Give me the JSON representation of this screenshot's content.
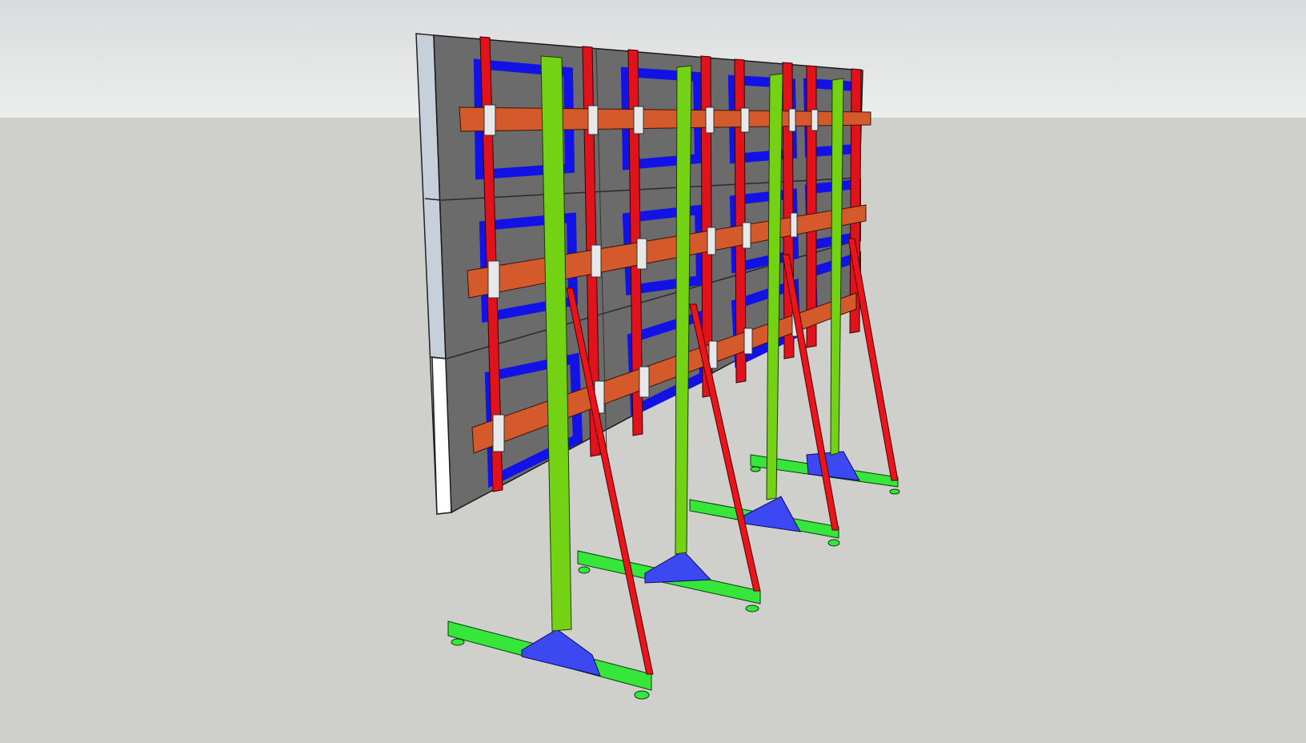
{
  "viewport": {
    "sky_color": "#e6e8e9",
    "ground_color": "#cfd0cc"
  },
  "model": {
    "components": [
      {
        "name": "wall-panel-face",
        "color": "#6d6d6d"
      },
      {
        "name": "wall-panel-edge",
        "color": "#c9d2dc"
      },
      {
        "name": "vertical-stiffener",
        "color": "#e0121c"
      },
      {
        "name": "panel-frame",
        "color": "#1416e6"
      },
      {
        "name": "horizontal-waler",
        "color": "#d85a2a"
      },
      {
        "name": "support-post",
        "color": "#74d214"
      },
      {
        "name": "base-rail",
        "color": "#36e63a"
      },
      {
        "name": "base-gusset",
        "color": "#3c48f2"
      },
      {
        "name": "diagonal-brace",
        "color": "#e8151c"
      }
    ],
    "support_count": 4,
    "waler_count": 3
  }
}
